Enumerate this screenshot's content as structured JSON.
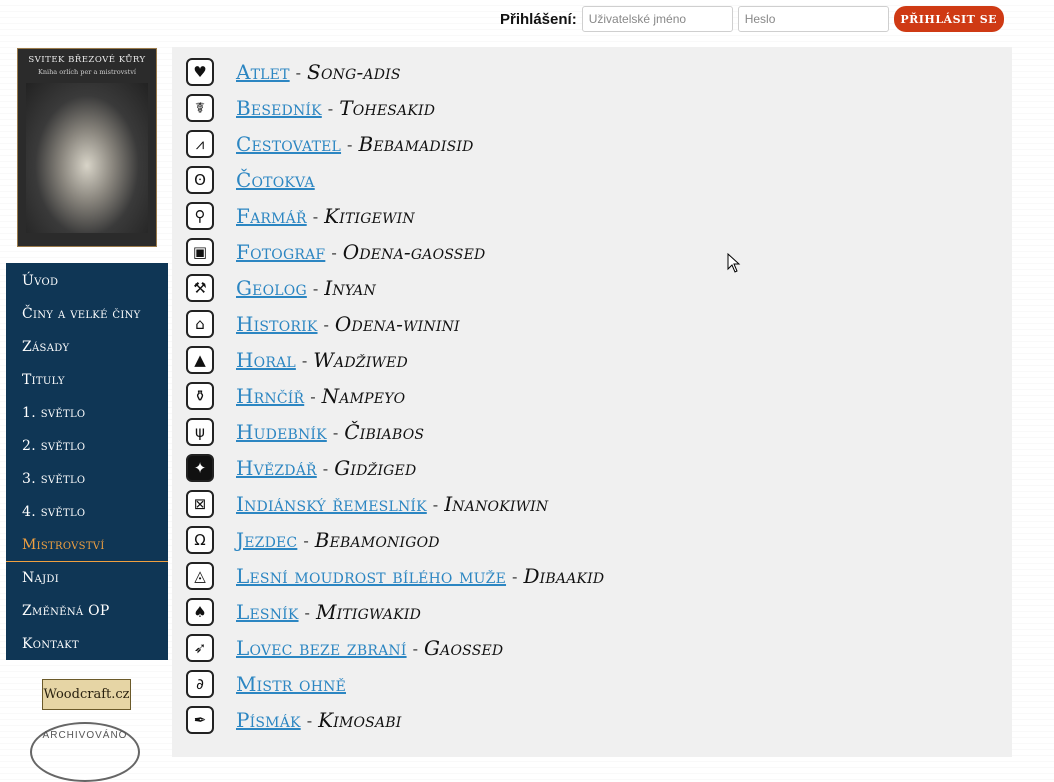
{
  "login": {
    "label": "Přihlášení:",
    "username_placeholder": "Uživatelské jméno",
    "password_placeholder": "Heslo",
    "submit_label": "Přihlásit se"
  },
  "cover": {
    "title": "SVITEK BŘEZOVÉ KŮRY",
    "subtitle": "Kniha orlích per a mistrovství"
  },
  "badge": {
    "text": "Woodcraft.cz"
  },
  "stamp": {
    "text": "ARCHIVOVÁNO"
  },
  "nav": {
    "items": [
      {
        "label": "Úvod"
      },
      {
        "label": "Činy a velké činy"
      },
      {
        "label": "Zásady"
      },
      {
        "label": "Tituly"
      },
      {
        "label": "1. světlo"
      },
      {
        "label": "2. světlo"
      },
      {
        "label": "3. světlo"
      },
      {
        "label": "4. světlo"
      },
      {
        "label": "Mistrovství",
        "active": true
      },
      {
        "label": "Najdi"
      },
      {
        "label": "Změněná OP"
      },
      {
        "label": "Kontakt"
      }
    ]
  },
  "masteries": [
    {
      "name": "Atlet",
      "indian": "Song-adis",
      "icon": "heart-icon"
    },
    {
      "name": "Besedník",
      "indian": "Tohesakid",
      "icon": "storyteller-icon"
    },
    {
      "name": "Cestovatel",
      "indian": "Bebamadisid",
      "icon": "mountains-icon"
    },
    {
      "name": "Čotokva",
      "indian": "",
      "icon": "owl-icon"
    },
    {
      "name": "Farmář",
      "indian": "Kitigewin",
      "icon": "shovel-icon"
    },
    {
      "name": "Fotograf",
      "indian": "Odena-gaossed",
      "icon": "camera-icon"
    },
    {
      "name": "Geolog",
      "indian": "Inyan",
      "icon": "hammer-icon"
    },
    {
      "name": "Historik",
      "indian": "Odena-winini",
      "icon": "temple-icon"
    },
    {
      "name": "Horal",
      "indian": "Wadžiwed",
      "icon": "mountain-icon"
    },
    {
      "name": "Hrnčíř",
      "indian": "Nampeyo",
      "icon": "pot-icon"
    },
    {
      "name": "Hudebník",
      "indian": "Čibiabos",
      "icon": "lyre-icon"
    },
    {
      "name": "Hvězdář",
      "indian": "Gidžiged",
      "icon": "star-icon"
    },
    {
      "name": "Indiánský řemeslník",
      "indian": "Inanokiwin",
      "icon": "hide-frame-icon"
    },
    {
      "name": "Jezdec",
      "indian": "Bebamonigod",
      "icon": "horseshoe-icon"
    },
    {
      "name": "Lesní moudrost bílého muže",
      "indian": "Dibaakid",
      "icon": "triangle-circle-icon"
    },
    {
      "name": "Lesník",
      "indian": "Mitigwakid",
      "icon": "tree-icon"
    },
    {
      "name": "Lovec beze zbraní",
      "indian": "Gaossed",
      "icon": "arrow-icon"
    },
    {
      "name": "Mistr ohně",
      "indian": "",
      "icon": "fire-steel-icon"
    },
    {
      "name": "Písmák",
      "indian": "Kimosabi",
      "icon": "pen-nib-icon"
    }
  ]
}
